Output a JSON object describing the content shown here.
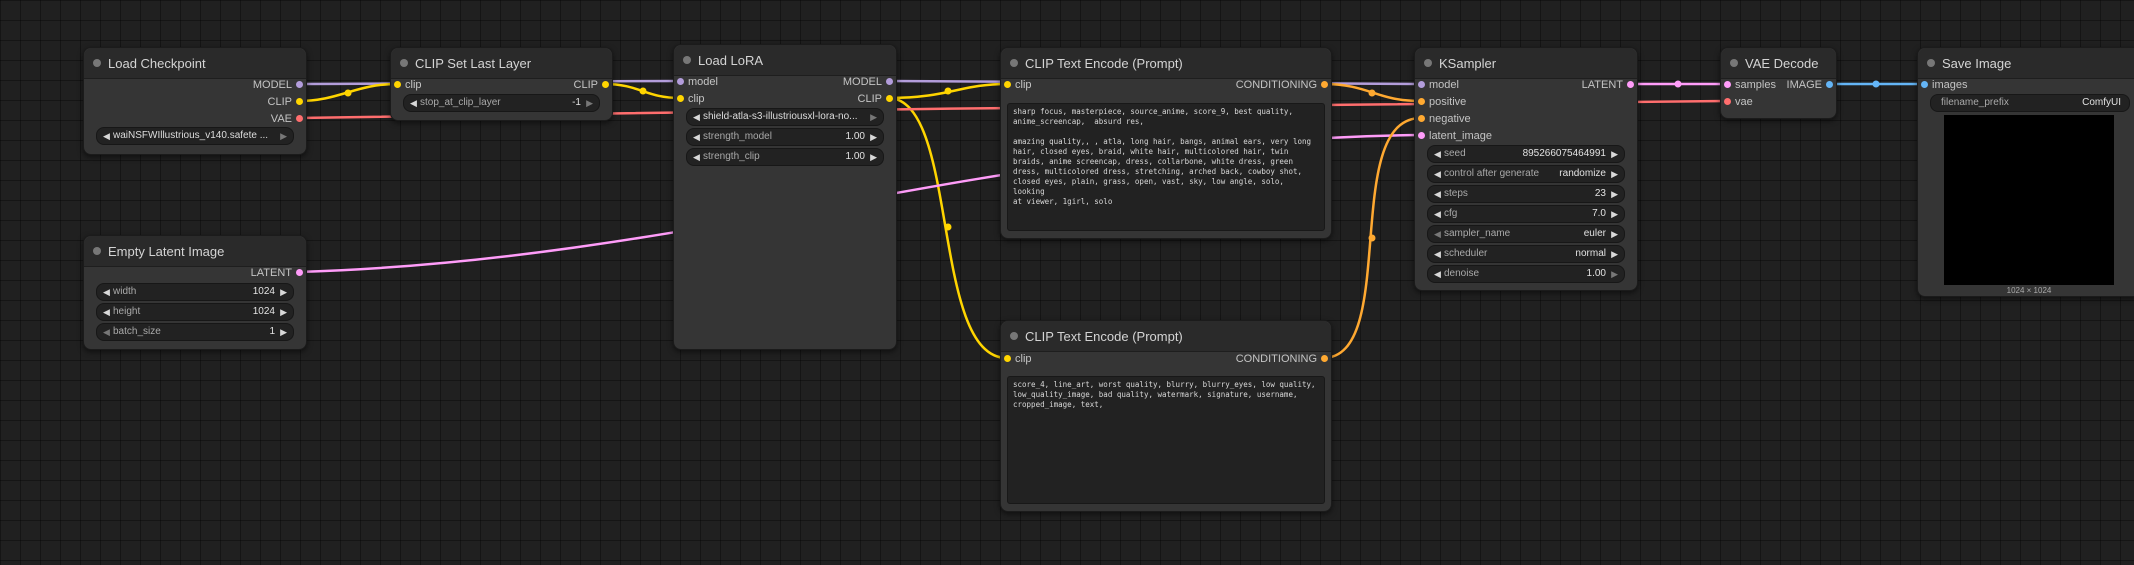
{
  "colors": {
    "model": "#b39ddb",
    "clip": "#ffd500",
    "vae": "#ff6e6e",
    "conditioning": "#ffa931",
    "latent": "#ff9cf9",
    "image": "#64b5f6"
  },
  "nodes": {
    "load_checkpoint": {
      "title": "Load Checkpoint",
      "outputs": [
        "MODEL",
        "CLIP",
        "VAE"
      ],
      "ckpt_name": "waiNSFWIllustrious_v140.safete ..."
    },
    "clip_set_last_layer": {
      "title": "CLIP Set Last Layer",
      "input": "clip",
      "output": "CLIP",
      "widget_label": "stop_at_clip_layer",
      "widget_value": "-1"
    },
    "load_lora": {
      "title": "Load LoRA",
      "inputs": [
        "model",
        "clip"
      ],
      "outputs": [
        "MODEL",
        "CLIP"
      ],
      "lora_name": "shield-atla-s3-illustriousxl-lora-no...",
      "strength_model_label": "strength_model",
      "strength_model": "1.00",
      "strength_clip_label": "strength_clip",
      "strength_clip": "1.00"
    },
    "empty_latent": {
      "title": "Empty Latent Image",
      "output": "LATENT",
      "width_label": "width",
      "width": "1024",
      "height_label": "height",
      "height": "1024",
      "batch_label": "batch_size",
      "batch_size": "1"
    },
    "clip_text_positive": {
      "title": "CLIP Text Encode (Prompt)",
      "input": "clip",
      "output": "CONDITIONING",
      "text": "sharp focus, masterpiece, source_anime, score_9, best quality,\nanime_screencap,  absurd res,\n\namazing quality,, , atla, long hair, bangs, animal ears, very long\nhair, closed eyes, braid, white hair, multicolored hair, twin\nbraids, anime screencap, dress, collarbone, white dress, green\ndress, multicolored dress, stretching, arched back, cowboy shot,\nclosed eyes, plain, grass, open, vast, sky, low angle, solo, looking\nat viewer, 1girl, solo"
    },
    "clip_text_negative": {
      "title": "CLIP Text Encode (Prompt)",
      "input": "clip",
      "output": "CONDITIONING",
      "text": "score_4, line_art, worst quality, blurry, blurry_eyes, low quality,\nlow_quality_image, bad quality, watermark, signature, username,\ncropped_image, text,"
    },
    "ksampler": {
      "title": "KSampler",
      "inputs": [
        "model",
        "positive",
        "negative",
        "latent_image"
      ],
      "output": "LATENT",
      "widgets": [
        {
          "label": "seed",
          "value": "895266075464991"
        },
        {
          "label": "control after generate",
          "value": "randomize"
        },
        {
          "label": "steps",
          "value": "23"
        },
        {
          "label": "cfg",
          "value": "7.0"
        },
        {
          "label": "sampler_name",
          "value": "euler"
        },
        {
          "label": "scheduler",
          "value": "normal"
        },
        {
          "label": "denoise",
          "value": "1.00"
        }
      ]
    },
    "vae_decode": {
      "title": "VAE Decode",
      "inputs": [
        "samples",
        "vae"
      ],
      "output": "IMAGE"
    },
    "save_image": {
      "title": "Save Image",
      "input": "images",
      "prefix_label": "filename_prefix",
      "prefix_value": "ComfyUI",
      "size_caption": "1024 × 1024"
    }
  }
}
